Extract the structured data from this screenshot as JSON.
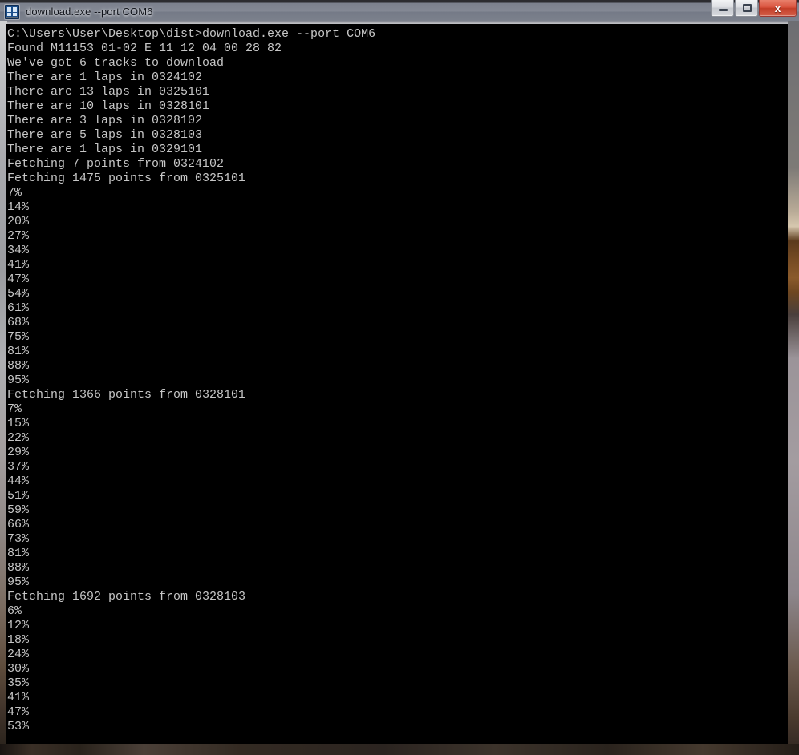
{
  "window": {
    "title": "download.exe --port COM6",
    "icon": "console-icon",
    "controls": {
      "minimize_label": "Minimize",
      "maximize_label": "Maximize",
      "close_label": "x"
    },
    "colors": {
      "console_background": "#000000",
      "console_foreground": "#c6c6c6",
      "close_button": "#c23d27",
      "titlebar": "#888d99"
    }
  },
  "console": {
    "prompt_path": "C:\\Users\\User\\Desktop\\dist>",
    "command": "download.exe --port COM6",
    "lines": [
      "C:\\Users\\User\\Desktop\\dist>download.exe --port COM6",
      "Found M11153 01-02 E 11 12 04 00 28 82",
      "We've got 6 tracks to download",
      "There are 1 laps in 0324102",
      "There are 13 laps in 0325101",
      "There are 10 laps in 0328101",
      "There are 3 laps in 0328102",
      "There are 5 laps in 0328103",
      "There are 1 laps in 0329101",
      "Fetching 7 points from 0324102",
      "Fetching 1475 points from 0325101",
      "7%",
      "14%",
      "20%",
      "27%",
      "34%",
      "41%",
      "47%",
      "54%",
      "61%",
      "68%",
      "75%",
      "81%",
      "88%",
      "95%",
      "Fetching 1366 points from 0328101",
      "7%",
      "15%",
      "22%",
      "29%",
      "37%",
      "44%",
      "51%",
      "59%",
      "66%",
      "73%",
      "81%",
      "88%",
      "95%",
      "Fetching 1692 points from 0328103",
      "6%",
      "12%",
      "18%",
      "24%",
      "30%",
      "35%",
      "41%",
      "47%",
      "53%"
    ],
    "device": {
      "id": "M11153",
      "firmware": "01-02",
      "mode": "E",
      "bytes": [
        "11",
        "12",
        "04",
        "00",
        "28",
        "82"
      ]
    },
    "track_count": 6,
    "tracks": [
      {
        "id": "0324102",
        "laps": 1,
        "points": 7,
        "progress": []
      },
      {
        "id": "0325101",
        "laps": 13,
        "points": 1475,
        "progress": [
          7,
          14,
          20,
          27,
          34,
          41,
          47,
          54,
          61,
          68,
          75,
          81,
          88,
          95
        ]
      },
      {
        "id": "0328101",
        "laps": 10,
        "points": 1366,
        "progress": [
          7,
          15,
          22,
          29,
          37,
          44,
          51,
          59,
          66,
          73,
          81,
          88,
          95
        ]
      },
      {
        "id": "0328102",
        "laps": 3,
        "points": null,
        "progress": []
      },
      {
        "id": "0328103",
        "laps": 5,
        "points": 1692,
        "progress": [
          6,
          12,
          18,
          24,
          30,
          35,
          41,
          47,
          53
        ]
      },
      {
        "id": "0329101",
        "laps": 1,
        "points": null,
        "progress": []
      }
    ]
  }
}
